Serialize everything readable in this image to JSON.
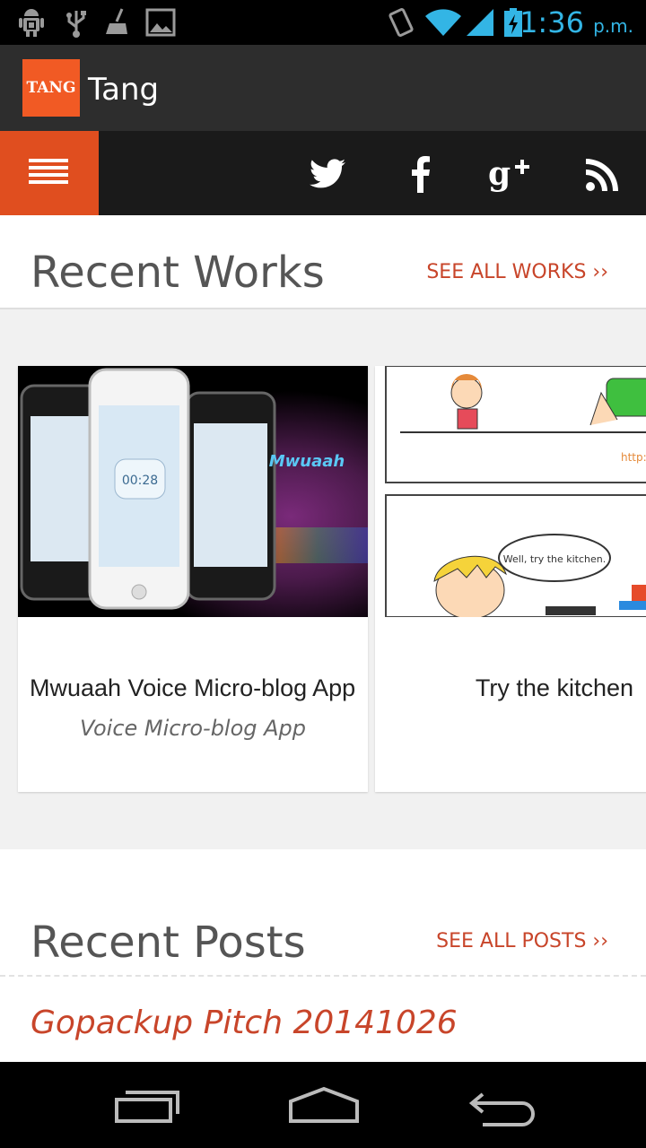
{
  "status_bar": {
    "time": "1:36",
    "ampm": "p.m.",
    "icons": [
      "android-debug-icon",
      "usb-icon",
      "cleanup-icon",
      "gallery-icon",
      "vibrate-icon",
      "wifi-icon",
      "signal-icon",
      "battery-charging-icon"
    ]
  },
  "action_bar": {
    "logo_text": "TANG",
    "title": "Tang"
  },
  "nav": {
    "social": [
      "twitter-icon",
      "facebook-icon",
      "google-plus-icon",
      "rss-icon"
    ]
  },
  "works": {
    "title": "Recent Works",
    "see_all": "SEE ALL WORKS ››",
    "cards": [
      {
        "title": "Mwuaah Voice Micro-blog App",
        "subtitle": "Voice Micro-blog App",
        "image_text": "Mwuaah",
        "clock": "00:28"
      },
      {
        "title": "Try the kitchen",
        "subtitle": "",
        "bubble": "Well, try the kitchen."
      }
    ]
  },
  "posts": {
    "title": "Recent Posts",
    "see_all": "SEE ALL POSTS ››",
    "items": [
      {
        "title": "Gopackup Pitch 20141026"
      }
    ]
  },
  "system_nav": [
    "recent-apps-icon",
    "home-icon",
    "back-icon"
  ]
}
